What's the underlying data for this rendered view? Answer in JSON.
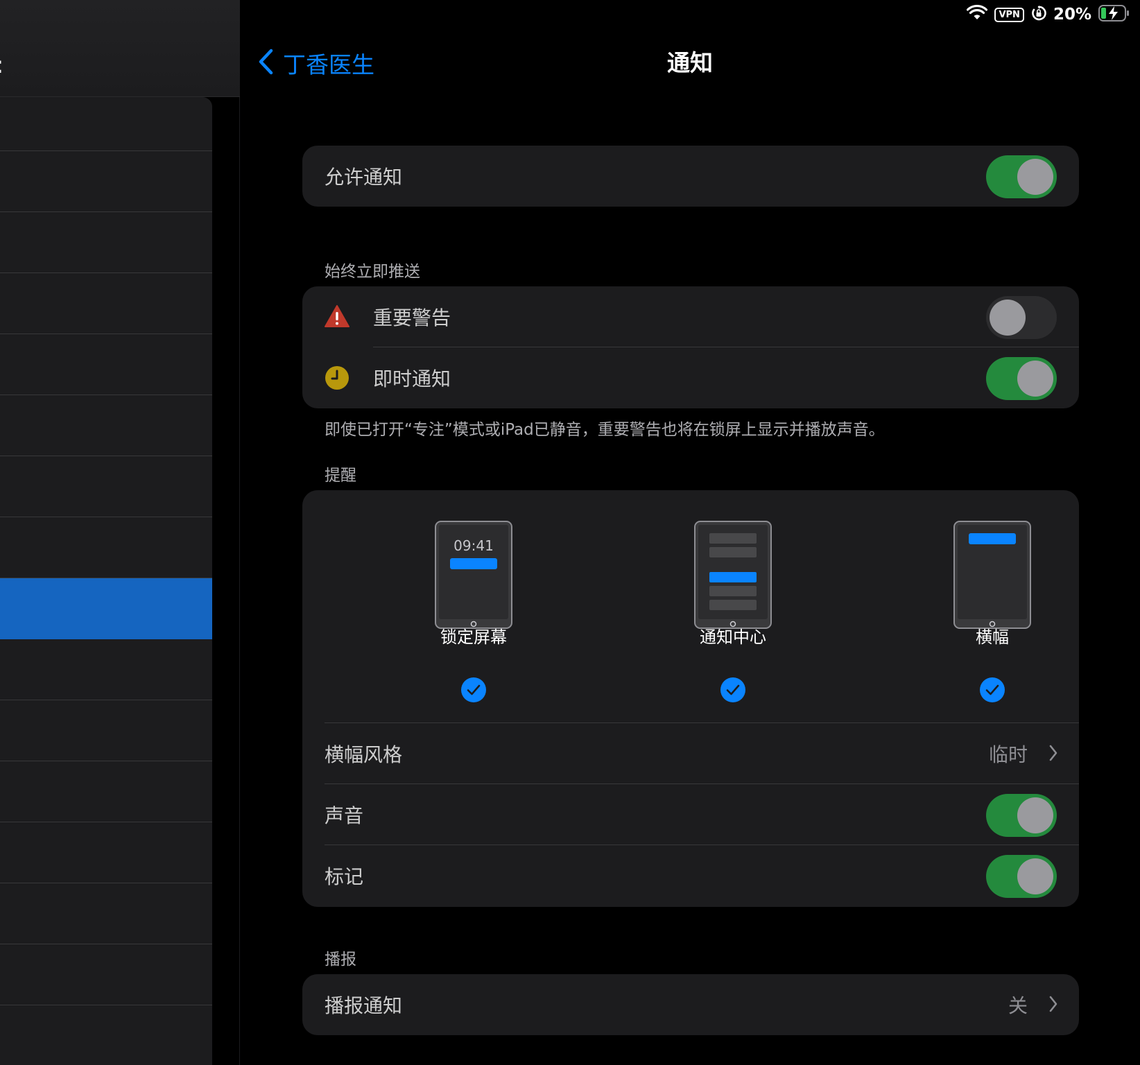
{
  "status_bar": {
    "vpn": "VPN",
    "battery": "20%"
  },
  "nav": {
    "back_label": "丁香医生",
    "title": "通知"
  },
  "allow": {
    "label": "允许通知",
    "on": true
  },
  "immediate": {
    "header": "始终立即推送",
    "critical_label": "重要警告",
    "critical_on": false,
    "timesensitive_label": "即时通知",
    "timesensitive_on": true,
    "footnote": "即使已打开“专注”模式或iPad已静音，重要警告也将在锁屏上显示并播放声音。"
  },
  "alerts": {
    "header": "提醒",
    "styles": [
      {
        "label": "锁定屏幕",
        "clock": "09:41",
        "checked": true
      },
      {
        "label": "通知中心",
        "checked": true
      },
      {
        "label": "横幅",
        "checked": true
      }
    ],
    "banner_style_label": "横幅风格",
    "banner_style_value": "临时",
    "sound_label": "声音",
    "sound_on": true,
    "badge_label": "标记",
    "badge_on": true
  },
  "announce": {
    "header": "播报",
    "label": "播报通知",
    "value": "关"
  },
  "colors": {
    "accent": "#0a84ff",
    "toggle_on": "#248a3d",
    "warning": "#c0392b",
    "clock": "#b8980c",
    "sidebar_selected": "#1565c0"
  }
}
